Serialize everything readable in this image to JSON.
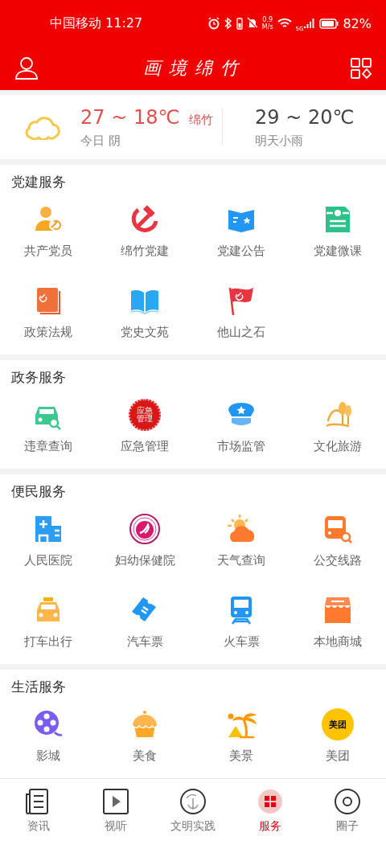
{
  "status_bar": {
    "carrier_time": "中国移动 11:27",
    "net_speed_value": "0.9",
    "net_speed_unit": "M/s",
    "network": "5G",
    "battery": "82%"
  },
  "header": {
    "logo": "画境绵竹"
  },
  "weather": {
    "today_range": "27 ~ 18℃",
    "city": "绵竹",
    "today_label": "今日 阴",
    "tomorrow_range": "29 ~ 20℃",
    "tomorrow_label": "明天小雨"
  },
  "sections": [
    {
      "title": "党建服务",
      "items": [
        {
          "label": "共产党员"
        },
        {
          "label": "绵竹党建"
        },
        {
          "label": "党建公告"
        },
        {
          "label": "党建微课"
        },
        {
          "label": "政策法规"
        },
        {
          "label": "党史文苑"
        },
        {
          "label": "他山之石"
        }
      ]
    },
    {
      "title": "政务服务",
      "items": [
        {
          "label": "违章查询"
        },
        {
          "label": "应急管理",
          "icon_text": "应急管理"
        },
        {
          "label": "市场监管"
        },
        {
          "label": "文化旅游"
        }
      ]
    },
    {
      "title": "便民服务",
      "items": [
        {
          "label": "人民医院"
        },
        {
          "label": "妇幼保健院"
        },
        {
          "label": "天气查询"
        },
        {
          "label": "公交线路"
        },
        {
          "label": "打车出行"
        },
        {
          "label": "汽车票"
        },
        {
          "label": "火车票"
        },
        {
          "label": "本地商城"
        }
      ]
    },
    {
      "title": "生活服务",
      "items": [
        {
          "label": "影城"
        },
        {
          "label": "美食"
        },
        {
          "label": "美景"
        },
        {
          "label": "美团",
          "icon_text": "美团"
        }
      ]
    }
  ],
  "bottom_nav": [
    {
      "label": "资讯",
      "selected": false
    },
    {
      "label": "视听",
      "selected": false
    },
    {
      "label": "文明实践",
      "selected": false
    },
    {
      "label": "服务",
      "selected": true
    },
    {
      "label": "圈子",
      "selected": false
    }
  ]
}
